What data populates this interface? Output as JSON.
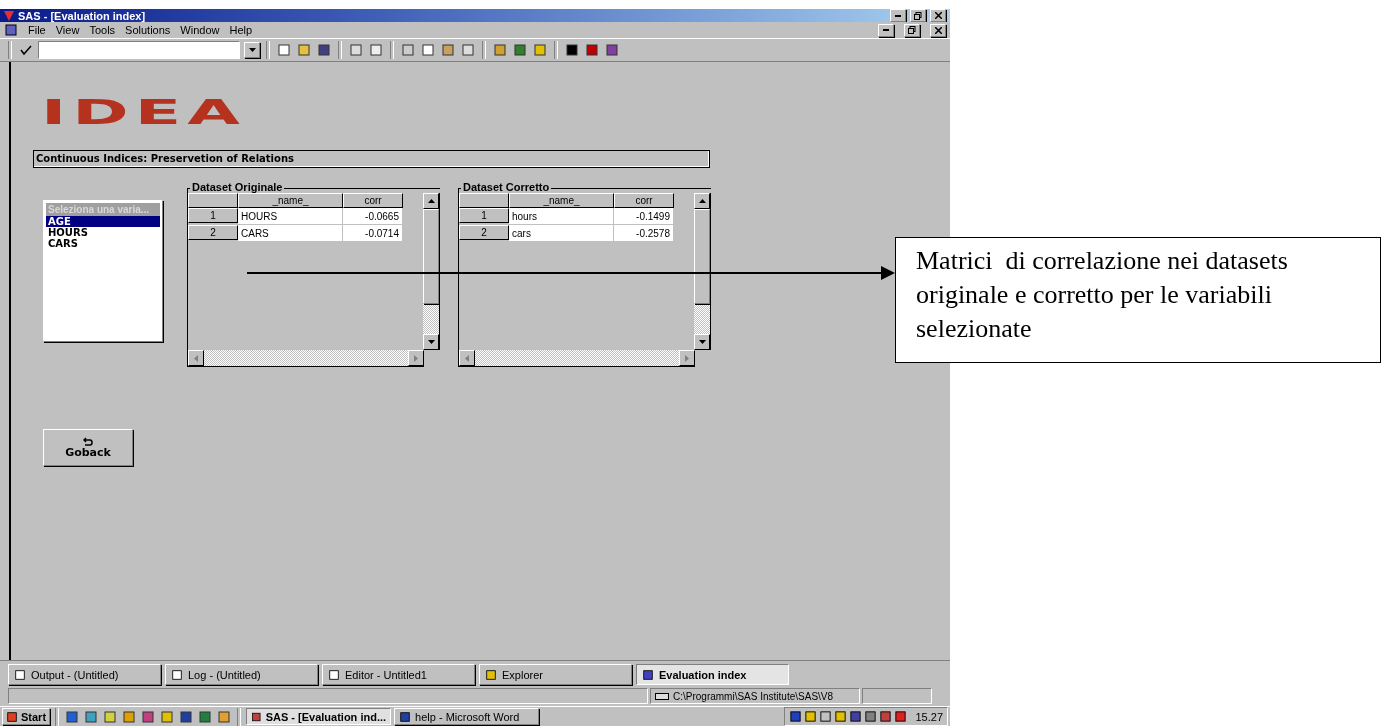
{
  "window": {
    "title": "SAS - [Evaluation index]"
  },
  "menu": [
    "File",
    "View",
    "Tools",
    "Solutions",
    "Window",
    "Help"
  ],
  "logo": "IDEA",
  "section_title": "Continuous Indices: Preservetion of Relations",
  "variable_list": {
    "header": "Seleziona una varia...",
    "items": [
      {
        "label": "AGE",
        "selected": true
      },
      {
        "label": "HOURS",
        "selected": false
      },
      {
        "label": "CARS",
        "selected": false
      }
    ]
  },
  "tables": [
    {
      "title": "Dataset Originale",
      "columns": [
        "",
        "_name_",
        "corr"
      ],
      "rows": [
        [
          "1",
          "HOURS",
          "-0.0665"
        ],
        [
          "2",
          "CARS",
          "-0.0714"
        ]
      ]
    },
    {
      "title": "Dataset Corretto",
      "columns": [
        "",
        "_name_",
        "corr"
      ],
      "rows": [
        [
          "1",
          "hours",
          "-0.1499"
        ],
        [
          "2",
          "cars",
          "-0.2578"
        ]
      ]
    }
  ],
  "goback_button": "Goback",
  "window_tabs": [
    {
      "label": "Output - (Untitled)",
      "selected": false
    },
    {
      "label": "Log - (Untitled)",
      "selected": false
    },
    {
      "label": "Editor - Untitled1",
      "selected": false
    },
    {
      "label": "Explorer",
      "selected": false
    },
    {
      "label": "Evaluation index",
      "selected": true
    }
  ],
  "status_bar": {
    "path": "C:\\Programmi\\SAS Institute\\SAS\\V8"
  },
  "taskbar": {
    "start": "Start",
    "tasks": [
      {
        "label": "SAS - [Evaluation ind...",
        "selected": true
      },
      {
        "label": "help - Microsoft Word",
        "selected": false
      }
    ],
    "clock": "15.27"
  },
  "annotation": "Matrici  di correlazione nei datasets originale e corretto per le variabili selezionate"
}
